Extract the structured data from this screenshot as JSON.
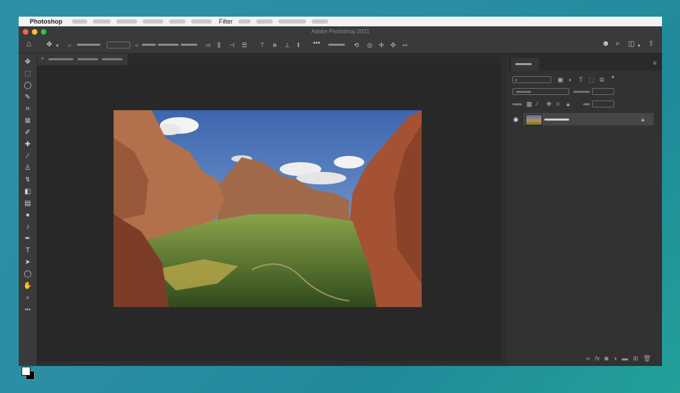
{
  "menubar": {
    "app": "Photoshop",
    "filter": "Filter"
  },
  "window": {
    "title": "Adobe Photoshop 2021"
  },
  "toolbar": {
    "tools": [
      {
        "name": "move-tool",
        "glyph": "✥"
      },
      {
        "name": "marquee-tool",
        "glyph": "⬚"
      },
      {
        "name": "lasso-tool",
        "glyph": "◯"
      },
      {
        "name": "quick-select-tool",
        "glyph": "✎"
      },
      {
        "name": "crop-tool",
        "glyph": "⌗"
      },
      {
        "name": "frame-tool",
        "glyph": "⊠"
      },
      {
        "name": "eyedropper-tool",
        "glyph": "✐"
      },
      {
        "name": "healing-brush-tool",
        "glyph": "✚"
      },
      {
        "name": "brush-tool",
        "glyph": "∕"
      },
      {
        "name": "clone-stamp-tool",
        "glyph": "♙"
      },
      {
        "name": "history-brush-tool",
        "glyph": "↯"
      },
      {
        "name": "eraser-tool",
        "glyph": "◧"
      },
      {
        "name": "gradient-tool",
        "glyph": "▤"
      },
      {
        "name": "blur-tool",
        "glyph": "●"
      },
      {
        "name": "dodge-tool",
        "glyph": "♪"
      },
      {
        "name": "pen-tool",
        "glyph": "✒"
      },
      {
        "name": "type-tool",
        "glyph": "T"
      },
      {
        "name": "path-select-tool",
        "glyph": "➤"
      },
      {
        "name": "shape-tool",
        "glyph": "◯"
      },
      {
        "name": "hand-tool",
        "glyph": "✋"
      },
      {
        "name": "zoom-tool",
        "glyph": "⌕"
      },
      {
        "name": "more-tools",
        "glyph": "•••"
      }
    ]
  },
  "panel": {
    "layer_lock_icon": "lock-icon"
  },
  "colors": {
    "bg_dark": "#323232",
    "canvas": "#282828",
    "menubar": "#f2f2f2"
  }
}
